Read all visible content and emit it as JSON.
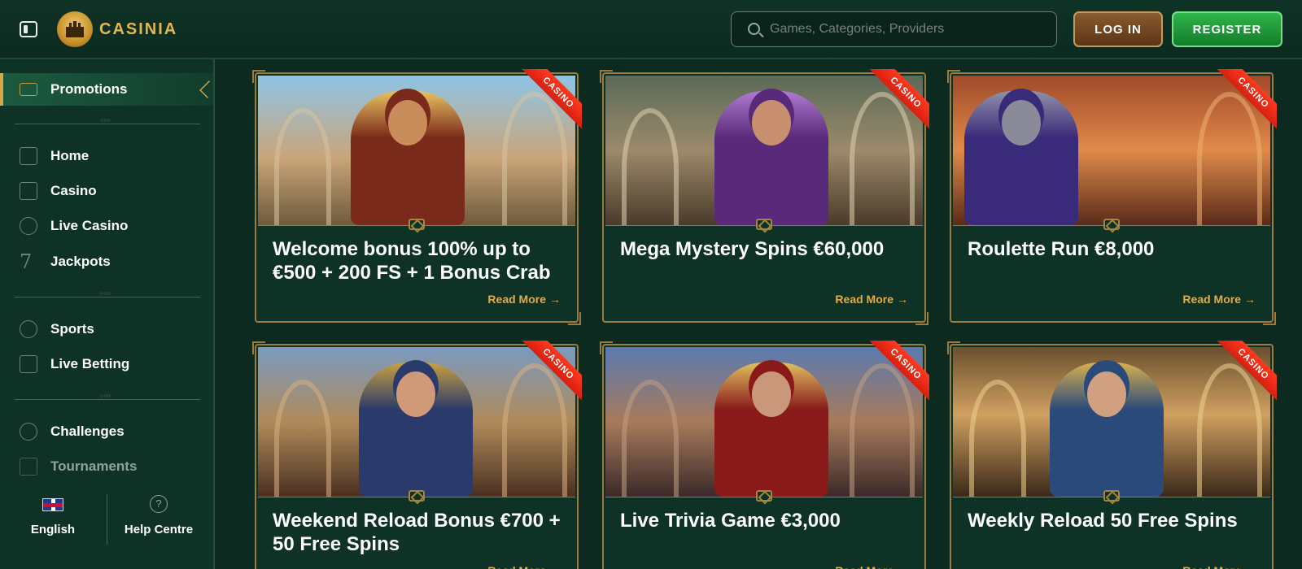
{
  "header": {
    "logo_text": "CASINIA",
    "search_placeholder": "Games, Categories, Providers",
    "login_label": "LOG IN",
    "register_label": "REGISTER"
  },
  "sidebar": {
    "promotions_label": "Promotions",
    "group1": [
      {
        "label": "Home",
        "icon": "castle-icon"
      },
      {
        "label": "Casino",
        "icon": "casino-building-icon"
      },
      {
        "label": "Live Casino",
        "icon": "chip-icon"
      },
      {
        "label": "Jackpots",
        "icon": "seven-icon"
      }
    ],
    "group2": [
      {
        "label": "Sports",
        "icon": "soccer-ball-icon"
      },
      {
        "label": "Live Betting",
        "icon": "live-shield-icon"
      }
    ],
    "group3": [
      {
        "label": "Challenges",
        "icon": "challenge-icon"
      },
      {
        "label": "Tournaments",
        "icon": "trophy-icon"
      }
    ],
    "footer": {
      "language_label": "English",
      "help_label": "Help Centre",
      "help_symbol": "?"
    }
  },
  "ribbon_label": "CASINO",
  "read_more_label": "Read More",
  "read_more_arrow": "→",
  "promos": [
    {
      "title": "Welcome bonus 100% up to €500 + 200 FS + 1 Bonus Crab",
      "palette": "king"
    },
    {
      "title": "Mega Mystery Spins €60,000",
      "palette": "lady"
    },
    {
      "title": "Roulette Run €8,000",
      "palette": "knight"
    },
    {
      "title": "Weekend Reload Bonus €700 + 50 Free Spins",
      "palette": "warrior"
    },
    {
      "title": "Live Trivia Game €3,000",
      "palette": "queen"
    },
    {
      "title": "Weekly Reload 50 Free Spins",
      "palette": "armor"
    }
  ],
  "colors": {
    "background": "#0d2a20",
    "gold": "#e0ac4c",
    "ribbon": "#e8281a",
    "register": "#1f9a3a",
    "login": "#6e4220"
  }
}
